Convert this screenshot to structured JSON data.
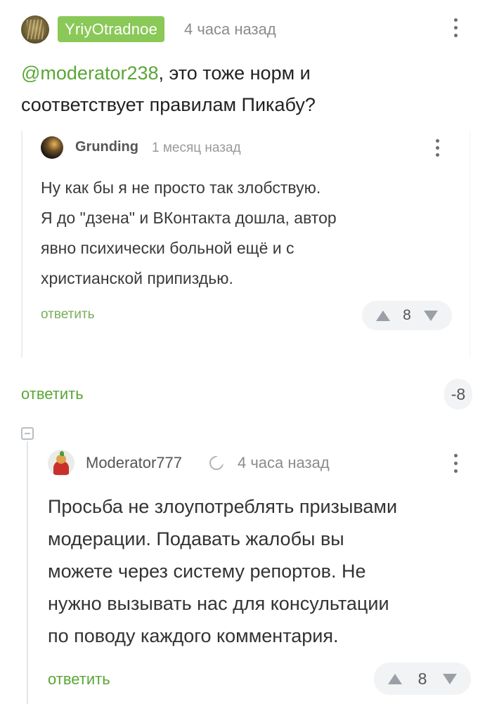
{
  "top_comment": {
    "username": "YriyOtradnoe",
    "time": "4 часа назад",
    "mention": "@moderator238",
    "text_line1": ", это тоже норм и",
    "text_line2": "соответствует правилам Пикабу?",
    "reply_label": "ответить",
    "score": "-8",
    "badge_color": "#8ac858"
  },
  "quoted_comment": {
    "username": "Grunding",
    "time": "1 месяц назад",
    "text_lines": [
      "Ну как бы я не просто так злобствую.",
      "Я до \"дзена\" и ВКонтакта дошла, автор",
      "явно психически больной ещё и с",
      "христианской припиздью."
    ],
    "reply_label": "ответить",
    "votes": "8"
  },
  "reply_comment": {
    "username": "Moderator777",
    "time": "4 часа назад",
    "text_lines": [
      "Просьба не злоупотреблять призывами",
      "модерации. Подавать жалобы вы",
      "можете через систему репортов. Не",
      "нужно вызывать нас для консультации",
      "по поводу каждого комментария."
    ],
    "reply_label": "ответить",
    "votes": "8"
  },
  "accent_color": "#5aa637"
}
